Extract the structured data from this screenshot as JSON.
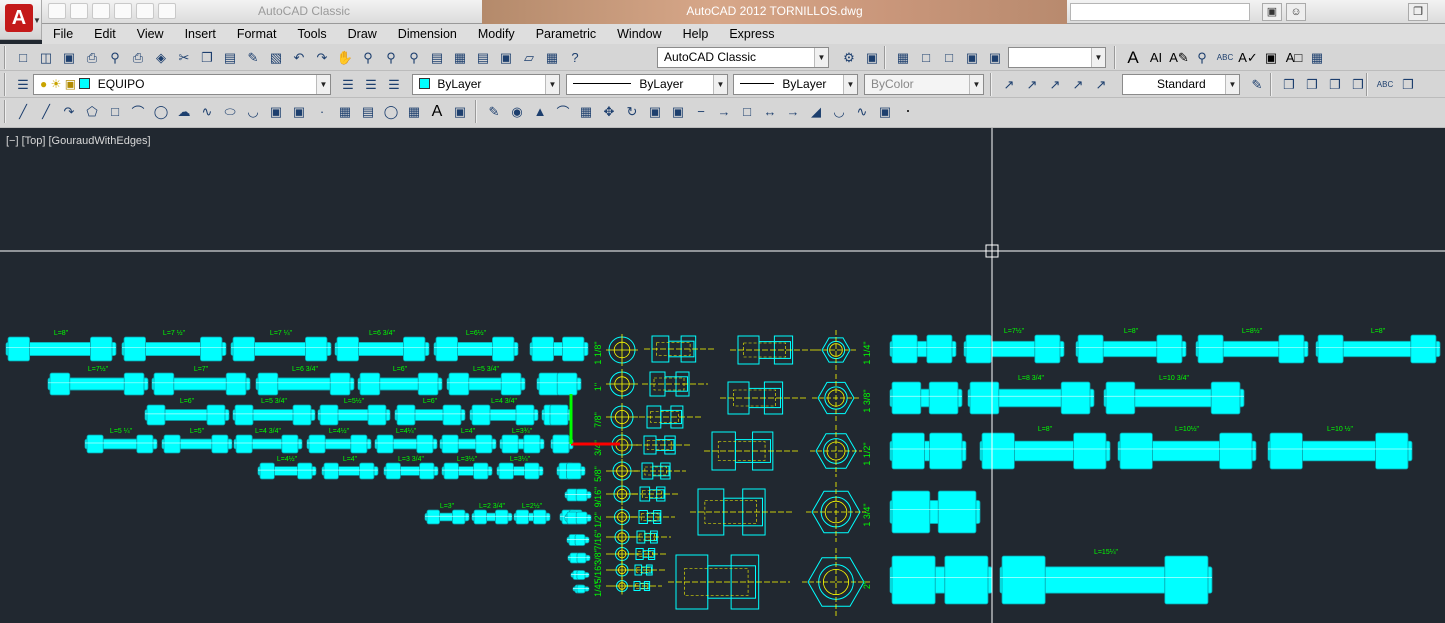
{
  "title": {
    "workspace_ghost": "AutoCAD Classic",
    "app_and_file": "AutoCAD 2012    TORNILLOS.dwg",
    "app_logo_letter": "A"
  },
  "menu": [
    "File",
    "Edit",
    "View",
    "Insert",
    "Format",
    "Tools",
    "Draw",
    "Dimension",
    "Modify",
    "Parametric",
    "Window",
    "Help",
    "Express"
  ],
  "toolbar1": {
    "workspace": "AutoCAD Classic",
    "search_value": ""
  },
  "toolbar2": {
    "layer": "EQUIPO",
    "color": "ByLayer",
    "linetype": "ByLayer",
    "lineweight": "ByLayer",
    "plotstyle": "ByColor",
    "textstyle": "Standard"
  },
  "viewport": {
    "label": "[−] [Top] [GouraudWithEdges]"
  },
  "colors": {
    "canvas": "#212830",
    "bolt": "#00ffff",
    "centerline": "#ffff00",
    "dim_text": "#00ff00",
    "crosshair": "#ffffff",
    "ucs_x": "#ff0000",
    "ucs_y": "#00ff00"
  },
  "drawing": {
    "length_labels_row1": [
      "L=8\"",
      "L=7 ½\"",
      "L=7 ¼\"",
      "L=6 3/4\"",
      "L=6½\""
    ],
    "length_labels_row2": [
      "L=7½\"",
      "L=7\"",
      "L=6 3/4\"",
      "L=6\"",
      "L=5 3/4\""
    ],
    "length_labels_row3": [
      "L=6\"",
      "L=5 3/4\"",
      "L=5½\"",
      "L=6\"",
      "L=4 3/4\""
    ],
    "length_labels_row4": [
      "L=5 ¼\"",
      "L=5\"",
      "L=4 3/4\"",
      "L=4½\"",
      "L=4¼\"",
      "L=4\"",
      "L=3¾\""
    ],
    "length_labels_row5": [
      "L=4½\"",
      "L=4\"",
      "L=3 3/4\"",
      "L=3½\"",
      "L=3¼\""
    ],
    "length_labels_row6": [
      "L=3\"",
      "L=2 3/4\"",
      "L=2½\""
    ],
    "right_labels_row1": [
      "L=7½\"",
      "L=8\"",
      "L=8½\"",
      "L=8\""
    ],
    "right_labels_row2": [
      "L=8 3/4\"",
      "L=10 3/4\""
    ],
    "right_labels_row3": [
      "L=8\"",
      "L=10½\"",
      "L=10 ½\""
    ],
    "right_labels_row5": [
      "L=15¼\""
    ],
    "size_labels_left": [
      "1 1/8\"",
      "1\"",
      "7/8\"",
      "3/4\"",
      "5/8\"",
      "9/16\"",
      "1/2\"",
      "7/16\"",
      "3/8\"",
      "5/16\"",
      "1/4\""
    ],
    "size_labels_right": [
      "1 1/4\"",
      "1 3/8\"",
      "1 1/2\"",
      "1 3/4\"",
      "2\""
    ]
  }
}
